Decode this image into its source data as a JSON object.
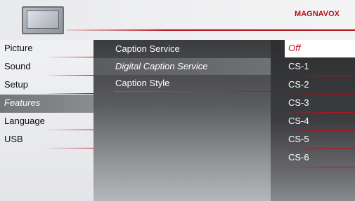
{
  "header": {
    "brand": "MAGNAVOX",
    "icon": "tv-icon"
  },
  "colors": {
    "accent": "#b5121b",
    "selected_left_bg": "#7d7f82",
    "right_selected_bg": "#ffffff"
  },
  "left_menu": {
    "items": [
      {
        "label": "Picture"
      },
      {
        "label": "Sound"
      },
      {
        "label": "Setup"
      },
      {
        "label": "Features"
      },
      {
        "label": "Language"
      },
      {
        "label": "USB"
      }
    ],
    "selected": "Features"
  },
  "middle_menu": {
    "items": [
      {
        "label": "Caption Service"
      },
      {
        "label": "Digital Caption Service"
      },
      {
        "label": "Caption Style"
      }
    ],
    "selected": "Digital Caption Service"
  },
  "right_menu": {
    "items": [
      {
        "label": "Off"
      },
      {
        "label": "CS-1"
      },
      {
        "label": "CS-2"
      },
      {
        "label": "CS-3"
      },
      {
        "label": "CS-4"
      },
      {
        "label": "CS-5"
      },
      {
        "label": "CS-6"
      }
    ],
    "selected": "Off"
  }
}
